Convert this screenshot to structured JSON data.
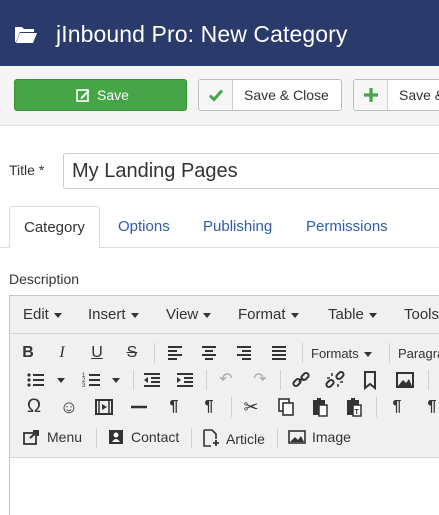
{
  "header": {
    "title": "jInbound Pro: New Category",
    "icon": "folder-open-icon",
    "bg": "#2a3a6a"
  },
  "toolbar": {
    "save_label": "Save",
    "save_close_label": "Save & Close",
    "save_new_label": "Save & New",
    "save_color": "#46a546"
  },
  "form": {
    "title_label": "Title *",
    "title_value": "My Landing Pages",
    "description_label": "Description"
  },
  "tabs": [
    {
      "label": "Category",
      "active": true
    },
    {
      "label": "Options"
    },
    {
      "label": "Publishing"
    },
    {
      "label": "Permissions"
    }
  ],
  "editor": {
    "menus": [
      "Edit",
      "Insert",
      "View",
      "Format",
      "Table",
      "Tools"
    ],
    "formats_label": "Formats",
    "paragraph_label": "Paragraph",
    "insert_buttons": [
      "Menu",
      "Contact",
      "Article",
      "Image"
    ]
  }
}
